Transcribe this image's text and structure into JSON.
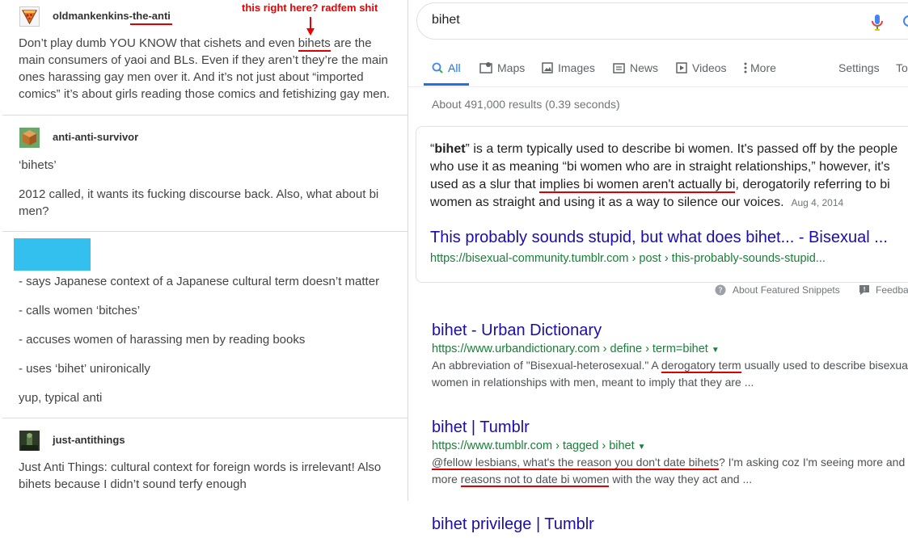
{
  "left": {
    "posts": [
      {
        "username_prefix": "oldmankenkins-",
        "username_suffix": "the-anti",
        "annotation": "this right here? radfem shit",
        "text_parts": [
          "Don’t play dumb YOU KNOW that cishets and even ",
          "bihets",
          " are the main consumers of yaoi and BLs. Even if they aren’t they’re the main ones harassing gay men over it. And it’s not just about “imported comics” it’s about girls reading those comics and fetishizing gay men."
        ]
      },
      {
        "username": "anti-anti-survivor",
        "lines": [
          "‘bihets’",
          "2012 called, it wants its fucking discourse back. Also, what about bi men?"
        ]
      },
      {
        "lines": [
          "- says Japanese context of a Japanese cultural term doesn’t matter",
          "- calls women ‘bitches’",
          "- accuses women of harassing men by reading books",
          "- uses ‘bihet’ unironically",
          "yup, typical anti"
        ],
        "redaction_color": "#33c0ee"
      },
      {
        "username": "just-antithings",
        "text": "Just Anti Things: cultural context for foreign words is irrelevant! Also bihets because I didn’t sound terfy enough"
      }
    ]
  },
  "google": {
    "query": "bihet",
    "tabs": [
      {
        "label": "All",
        "icon": "search-icon",
        "active": true
      },
      {
        "label": "Maps",
        "icon": "map-icon"
      },
      {
        "label": "Images",
        "icon": "image-icon"
      },
      {
        "label": "News",
        "icon": "news-icon"
      },
      {
        "label": "Videos",
        "icon": "video-icon"
      },
      {
        "label": "More",
        "icon": "more-vert-icon"
      }
    ],
    "settings": "Settings",
    "tools": "Tools",
    "stats": "About 491,000 results (0.39 seconds)",
    "snippet": {
      "term": "bihet",
      "text_a": "” is a term typically used to describe bi women. It's passed off by the people who use it as meaning “bi women who are in straight relationships,” however, it's used as a slur that ",
      "text_highlight": "implies bi women aren't actually bi",
      "text_b": ", derogatorily referring to bi women as straight and using it as a way to silence our voices.",
      "date": "Aug 4, 2014",
      "title": "This probably sounds stupid, but what does bihet... - Bisexual ...",
      "url": "https://bisexual-community.tumblr.com › post › this-probably-sounds-stupid..."
    },
    "about_snippets": "About Featured Snippets",
    "feedback": "Feedback",
    "results": [
      {
        "title": "bihet - Urban Dictionary",
        "url": "https://www.urbandictionary.com › define › term=bihet",
        "line1_a": "An abbreviation of \"Bisexual-heterosexual.\" A ",
        "line1_hl": "derogatory term",
        "line1_b": " usually used to describe bisexual",
        "line2": "women in relationships with men, meant to imply that they are ..."
      },
      {
        "title": "bihet | Tumblr",
        "url": "https://www.tumblr.com › tagged › bihet",
        "line1_hl": "@fellow lesbians, what's the reason you don't date bihets",
        "line1_b": "? I'm asking coz I'm seeing more and",
        "line2_a": "more ",
        "line2_hl": "reasons not to date bi women",
        "line2_b": " with the way they act and ..."
      },
      {
        "title": "bihet privilege | Tumblr"
      }
    ]
  },
  "colors": {
    "link": "#1a0dab",
    "url_green": "#188038",
    "annotation_red": "#e00000",
    "google_blue": "#1a73e8"
  }
}
